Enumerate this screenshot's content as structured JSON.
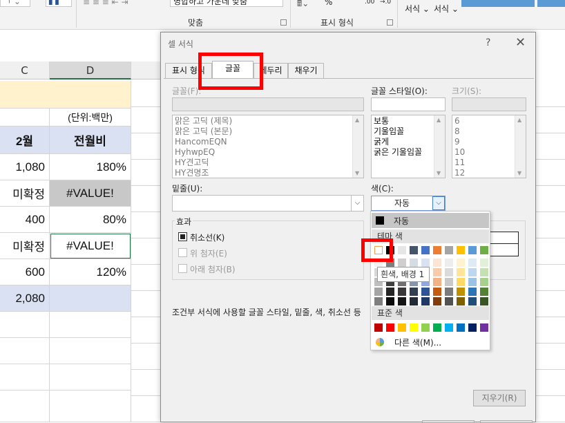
{
  "ribbon": {
    "group_align": "맞춤",
    "merge_center": "병합하고 가운데 맞춤",
    "group_number": "표시 형식",
    "percent": "%",
    "decimals": ".00",
    "decimals_inc": "→.0",
    "format_cond": "서식",
    "format_table": "서식"
  },
  "sheet": {
    "columns": [
      "C",
      "D"
    ],
    "unit": "(단위:백만)",
    "header": [
      "2월",
      "전월비"
    ],
    "rows": [
      [
        "1,080",
        "180%"
      ],
      [
        "미확정",
        "#VALUE!"
      ],
      [
        "400",
        "80%"
      ],
      [
        "미확정",
        "#VALUE!"
      ],
      [
        "600",
        "120%"
      ],
      [
        "2,080",
        ""
      ]
    ]
  },
  "dialog": {
    "title": "셀 서식",
    "help": "?",
    "close": "✕",
    "tabs": [
      "표시 형식",
      "글꼴",
      "테두리",
      "채우기"
    ],
    "font_label": "글꼴(F):",
    "fonts": [
      "맑은 고딕 (제목)",
      "맑은 고딕 (본문)",
      "HancomEQN",
      "HyhwpEQ",
      "HY견고딕",
      "HY견명조"
    ],
    "style_label": "글꼴 스타일(O):",
    "styles": [
      "보통",
      "기울임꼴",
      "굵게",
      "굵은 기울임꼴"
    ],
    "size_label": "크기(S):",
    "sizes": [
      "6",
      "8",
      "9",
      "10",
      "11",
      "12"
    ],
    "underline_label": "밑줄(U):",
    "color_label": "색(C):",
    "color_value": "자동",
    "effects_label": "효과",
    "strike_label": "취소선(K)",
    "super_label": "위 첨자(E)",
    "sub_label": "아래 첨자(B)",
    "description": "조건부 서식에 사용할 글꼴 스타일, 밑줄, 색, 취소선 등",
    "clear_button": "지우기(R)"
  },
  "color_popup": {
    "auto_label": "자동",
    "theme_label": "테마 색",
    "standard_label": "표준 색",
    "more_colors": "다른 색(M)...",
    "tooltip": "흰색, 배경 1",
    "theme_colors": [
      "#ffffff",
      "#000000",
      "#e7e6e6",
      "#44546a",
      "#4472c4",
      "#ed7d31",
      "#a5a5a5",
      "#ffc000",
      "#5b9bd5",
      "#70ad47"
    ],
    "theme_tints": [
      [
        "#f2f2f2",
        "#7f7f7f",
        "#d0cece",
        "#d6dce4",
        "#d9e2f3",
        "#fbe5d5",
        "#ededed",
        "#fff2cc",
        "#deebf6",
        "#e2efd9"
      ],
      [
        "#d8d8d8",
        "#595959",
        "#aeaaaa",
        "#adb9ca",
        "#b4c6e7",
        "#f7cbac",
        "#dbdbdb",
        "#fee599",
        "#bdd7ee",
        "#c5e0b3"
      ],
      [
        "#bfbfbf",
        "#3f3f3f",
        "#757070",
        "#8496b0",
        "#8eaadb",
        "#f4b183",
        "#c9c9c9",
        "#ffd965",
        "#9cc3e5",
        "#a8d08d"
      ],
      [
        "#a5a5a5",
        "#262626",
        "#3a3838",
        "#323f4f",
        "#2f5496",
        "#c55a11",
        "#7b7b7b",
        "#bf9000",
        "#2e75b5",
        "#538135"
      ],
      [
        "#7f7f7f",
        "#0c0c0c",
        "#171616",
        "#222a35",
        "#1f3864",
        "#833c0b",
        "#525252",
        "#7f6000",
        "#1e4e79",
        "#375623"
      ]
    ],
    "standard_colors": [
      "#c00000",
      "#ff0000",
      "#ffc000",
      "#ffff00",
      "#92d050",
      "#00b050",
      "#00b0f0",
      "#0070c0",
      "#002060",
      "#7030a0"
    ]
  }
}
